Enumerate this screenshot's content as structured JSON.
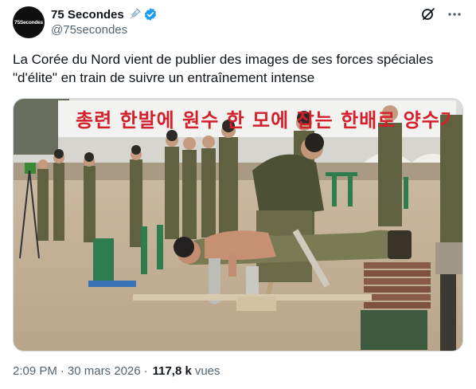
{
  "account": {
    "avatar_text": "75Secondes",
    "display_name": "75 Secondes",
    "handle": "@75secondes",
    "verified_color": "#1d9bf0"
  },
  "icons": {
    "name_emoji": "syringe-icon",
    "verified": "verified-badge-icon",
    "grok": "grok-icon",
    "more": "more-options-icon"
  },
  "tweet": {
    "line1": "La Corée du Nord vient de publier des images de ses forces spéciales",
    "line2": "\"d'élite\" en train de suivre un entraînement intense"
  },
  "media": {
    "banner_text": "총련 한발에 원수 한 모에 잡는 한배로 양수가"
  },
  "meta": {
    "time": "2:09 PM",
    "separator": "·",
    "date": "30 mars 2026",
    "views_count": "117,8 k",
    "views_label": "vues"
  }
}
